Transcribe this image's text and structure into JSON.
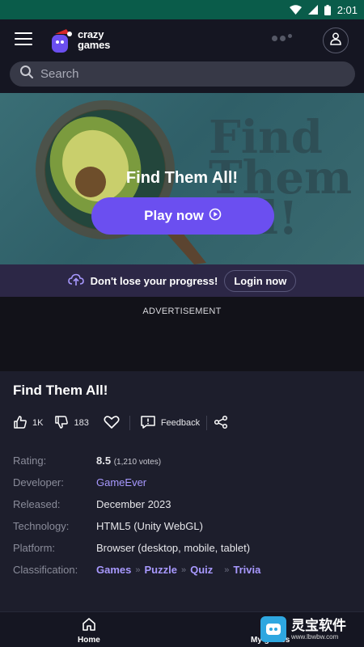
{
  "status_bar": {
    "time": "2:01"
  },
  "header": {
    "logo_line1": "crazy",
    "logo_line2": "games"
  },
  "search": {
    "placeholder": "Search"
  },
  "hero": {
    "background_text_lines": [
      "Find",
      "Them",
      "All!"
    ],
    "title": "Find Them All!",
    "play_label": "Play now"
  },
  "progress_banner": {
    "message": "Don't lose your progress!",
    "login_label": "Login now"
  },
  "ad": {
    "label": "ADVERTISEMENT"
  },
  "game": {
    "title": "Find Them All!",
    "likes": "1K",
    "dislikes": "183",
    "feedback_label": "Feedback",
    "info": {
      "rating_label": "Rating:",
      "rating_value": "8.5",
      "rating_votes": "(1,210 votes)",
      "developer_label": "Developer:",
      "developer_value": "GameEver",
      "released_label": "Released:",
      "released_value": "December 2023",
      "technology_label": "Technology:",
      "technology_value": "HTML5 (Unity WebGL)",
      "platform_label": "Platform:",
      "platform_value": "Browser (desktop, mobile, tablet)",
      "classification_label": "Classification:",
      "classification_tags": [
        "Games",
        "Puzzle",
        "Quiz",
        "Trivia"
      ],
      "tag_separator": "»"
    }
  },
  "bottom_nav": {
    "home_label": "Home",
    "my_games_label": "My games"
  },
  "watermark": {
    "text": "灵宝软件",
    "url": "www.lbwbw.com"
  },
  "colors": {
    "accent": "#6b4ff0",
    "link": "#a899ff",
    "status_bar": "#0a5c4a",
    "background": "#1d1e2c"
  }
}
